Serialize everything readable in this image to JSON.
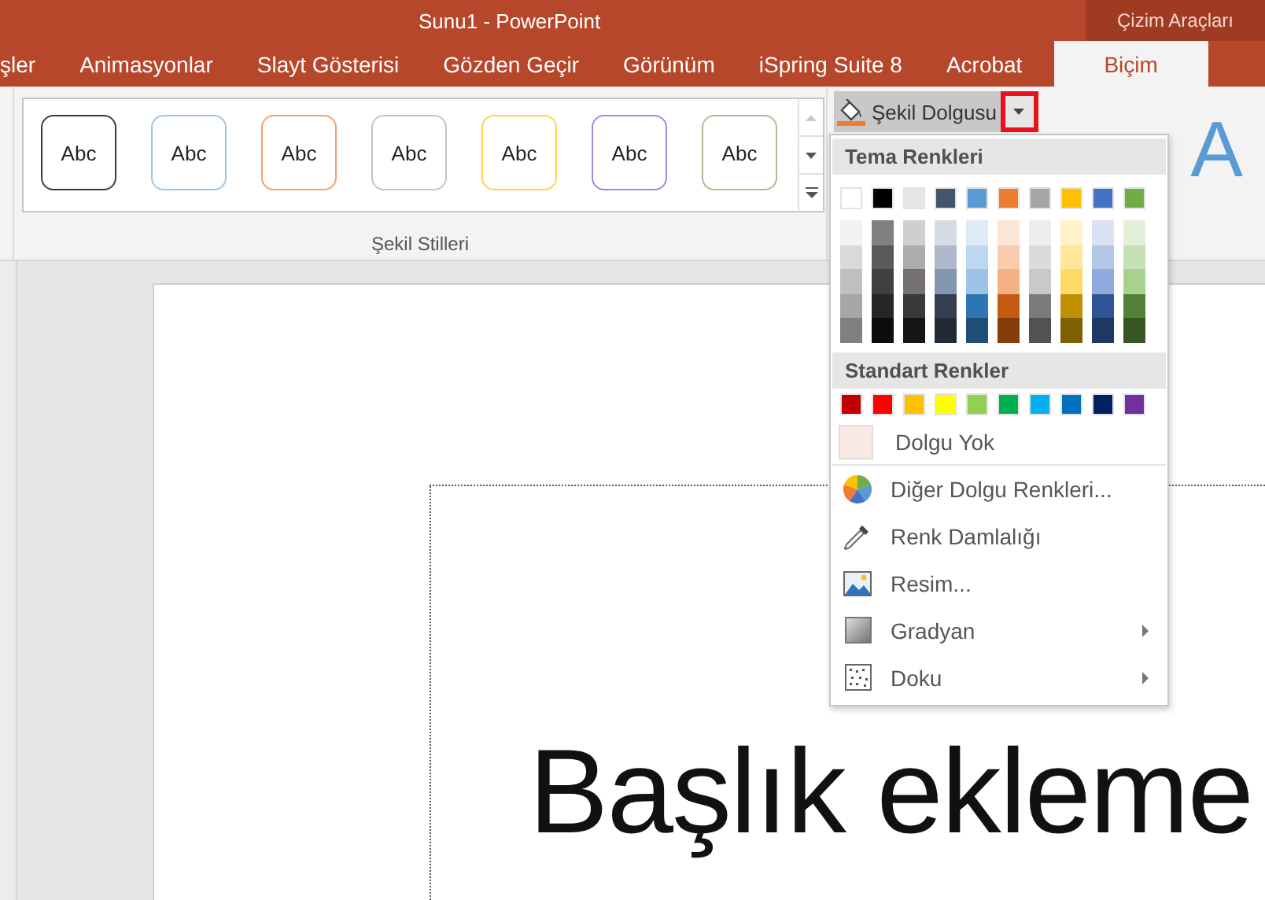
{
  "window": {
    "title": "Sunu1 - PowerPoint"
  },
  "contextual_tab_group": "Çizim Araçları",
  "tabs": [
    {
      "label": "şler",
      "selected": false
    },
    {
      "label": "Animasyonlar",
      "selected": false
    },
    {
      "label": "Slayt Gösterisi",
      "selected": false
    },
    {
      "label": "Gözden Geçir",
      "selected": false
    },
    {
      "label": "Görünüm",
      "selected": false
    },
    {
      "label": "iSpring Suite 8",
      "selected": false
    },
    {
      "label": "Acrobat",
      "selected": false
    },
    {
      "label": "Biçim",
      "selected": true
    }
  ],
  "shape_styles": {
    "label": "Şekil Stilleri",
    "styles": [
      {
        "text": "Abc",
        "color": "#3a3a3a"
      },
      {
        "text": "Abc",
        "color": "#9dc3e6"
      },
      {
        "text": "Abc",
        "color": "#f4a06a"
      },
      {
        "text": "Abc",
        "color": "#c4c4c4"
      },
      {
        "text": "Abc",
        "color": "#ffd24d"
      },
      {
        "text": "Abc",
        "color": "#8e8ee8"
      },
      {
        "text": "Abc",
        "color": "#a9bd8e"
      }
    ]
  },
  "shape_fill_button": {
    "label": "Şekil Dolgusu",
    "pressed": true,
    "arrow_highlighted": true
  },
  "wordart_sample": "A",
  "fill_menu": {
    "theme_header": "Tema Renkleri",
    "theme_colors": [
      {
        "color": "#ffffff",
        "shades": [
          {
            "color": "#f2f2f2"
          },
          {
            "color": "#d9d9d9"
          },
          {
            "color": "#bfbfbf"
          },
          {
            "color": "#a6a6a6"
          },
          {
            "color": "#808080"
          }
        ]
      },
      {
        "color": "#000000",
        "shades": [
          {
            "color": "#808080"
          },
          {
            "color": "#595959"
          },
          {
            "color": "#404040"
          },
          {
            "color": "#262626"
          },
          {
            "color": "#0d0d0d"
          }
        ]
      },
      {
        "color": "#e7e6e6",
        "shades": [
          {
            "color": "#d0cece"
          },
          {
            "color": "#aeabab"
          },
          {
            "color": "#757171"
          },
          {
            "color": "#3a3838"
          },
          {
            "color": "#171616"
          }
        ]
      },
      {
        "color": "#44546a",
        "shades": [
          {
            "color": "#d6dce4"
          },
          {
            "color": "#adb9ca"
          },
          {
            "color": "#8497b0"
          },
          {
            "color": "#333f4f"
          },
          {
            "color": "#222a35"
          }
        ]
      },
      {
        "color": "#5b9bd5",
        "shades": [
          {
            "color": "#deebf6"
          },
          {
            "color": "#bdd7ee"
          },
          {
            "color": "#9dc3e6"
          },
          {
            "color": "#2e75b5"
          },
          {
            "color": "#1f4e79"
          }
        ]
      },
      {
        "color": "#ed7d31",
        "shades": [
          {
            "color": "#fbe5d5"
          },
          {
            "color": "#f8cbad"
          },
          {
            "color": "#f4b183"
          },
          {
            "color": "#c55a11"
          },
          {
            "color": "#843c0b"
          }
        ]
      },
      {
        "color": "#a5a5a5",
        "shades": [
          {
            "color": "#ededed"
          },
          {
            "color": "#dbdbdb"
          },
          {
            "color": "#c9c9c9"
          },
          {
            "color": "#7b7b7b"
          },
          {
            "color": "#525252"
          }
        ]
      },
      {
        "color": "#ffc000",
        "shades": [
          {
            "color": "#fff2cc"
          },
          {
            "color": "#ffe699"
          },
          {
            "color": "#ffd966"
          },
          {
            "color": "#bf9000"
          },
          {
            "color": "#7f6000"
          }
        ]
      },
      {
        "color": "#4472c4",
        "shades": [
          {
            "color": "#dae3f3"
          },
          {
            "color": "#b4c7e7"
          },
          {
            "color": "#8faadc"
          },
          {
            "color": "#2f5597"
          },
          {
            "color": "#203864"
          }
        ]
      },
      {
        "color": "#70ad47",
        "shades": [
          {
            "color": "#e2f0d9"
          },
          {
            "color": "#c5e0b4"
          },
          {
            "color": "#a9d18e"
          },
          {
            "color": "#538135"
          },
          {
            "color": "#375623"
          }
        ]
      }
    ],
    "standard_header": "Standart Renkler",
    "standard_colors": [
      {
        "color": "#c00000"
      },
      {
        "color": "#ff0000"
      },
      {
        "color": "#ffc000"
      },
      {
        "color": "#ffff00"
      },
      {
        "color": "#92d050"
      },
      {
        "color": "#00b050"
      },
      {
        "color": "#00b0f0"
      },
      {
        "color": "#0070c0"
      },
      {
        "color": "#002060"
      },
      {
        "color": "#7030a0"
      }
    ],
    "no_fill": {
      "label": "Dolgu Yok"
    },
    "items": [
      {
        "kind": "palette",
        "label": "Diğer Dolgu Renkleri...",
        "has_submenu": false
      },
      {
        "kind": "eyedropper",
        "label": "Renk Damlalığı",
        "has_submenu": false
      },
      {
        "kind": "picture",
        "label": "Resim...",
        "has_submenu": false
      },
      {
        "kind": "gradient",
        "label": "Gradyan",
        "has_submenu": true
      },
      {
        "kind": "texture",
        "label": "Doku",
        "has_submenu": true
      }
    ]
  },
  "slide": {
    "title_placeholder": "Başlık ekleme"
  }
}
